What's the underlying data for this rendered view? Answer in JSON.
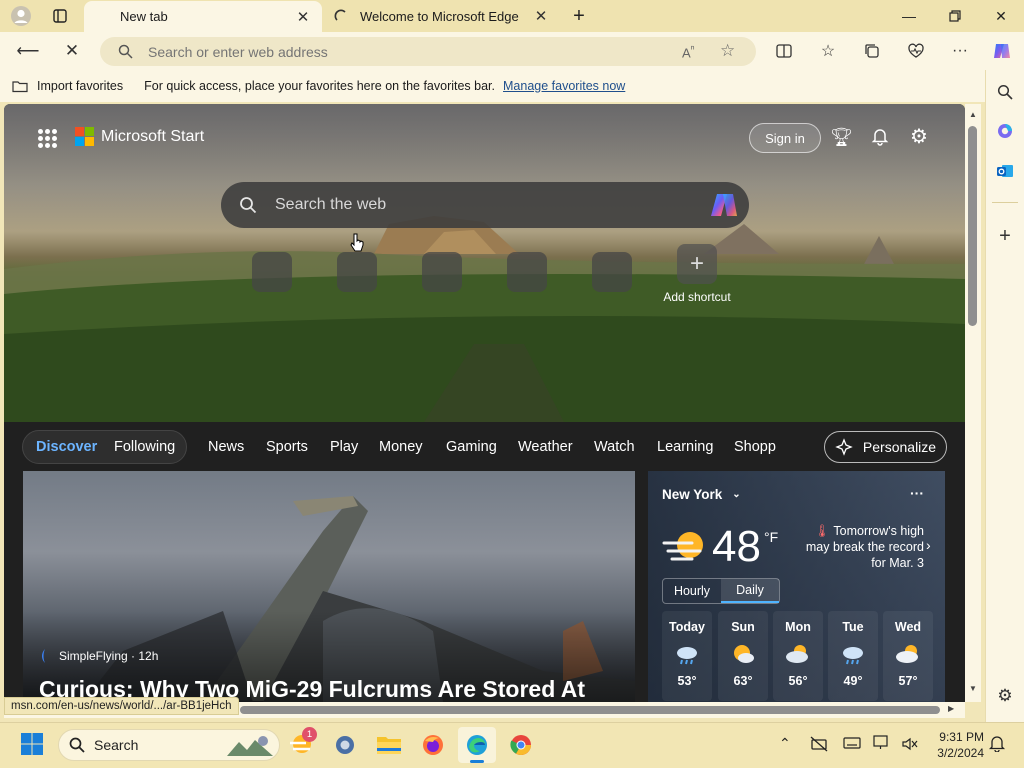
{
  "browser": {
    "tabs": [
      {
        "label": "New tab",
        "active": true
      },
      {
        "label": "Welcome to Microsoft Edge",
        "active": false
      }
    ],
    "address_placeholder": "Search or enter web address",
    "favorites_bar": {
      "import_label": "Import favorites",
      "hint": "For quick access, place your favorites here on the favorites bar.",
      "manage_link": "Manage favorites now"
    },
    "status_url": "msn.com/en-us/news/world/.../ar-BB1jeHch"
  },
  "page": {
    "brand": "Microsoft Start",
    "sign_in": "Sign in",
    "search_placeholder": "Search the web",
    "add_shortcut": "Add shortcut",
    "feed_tabs": [
      "Discover",
      "Following",
      "News",
      "Sports",
      "Play",
      "Money",
      "Gaming",
      "Weather",
      "Watch",
      "Learning",
      "Shopp"
    ],
    "active_feed_tab": "Discover",
    "personalize": "Personalize",
    "news": {
      "source": "SimpleFlying · 12h",
      "headline": "Curious: Why Two MiG-29 Fulcrums Are Stored At"
    },
    "weather": {
      "location": "New York",
      "temperature": "48",
      "unit": "°F",
      "note": "Tomorrow's high may break the record for Mar. 3",
      "toggle": [
        "Hourly",
        "Daily"
      ],
      "active_toggle": "Daily",
      "days": [
        {
          "day": "Today",
          "temp": "53°",
          "icon": "rain-cloud-icon"
        },
        {
          "day": "Sun",
          "temp": "63°",
          "icon": "partly-sunny-icon"
        },
        {
          "day": "Mon",
          "temp": "56°",
          "icon": "cloudy-icon"
        },
        {
          "day": "Tue",
          "temp": "49°",
          "icon": "rain-cloud-icon"
        },
        {
          "day": "Wed",
          "temp": "57°",
          "icon": "partly-cloudy-icon"
        }
      ]
    }
  },
  "taskbar": {
    "search_label": "Search",
    "notification_count": "1",
    "time": "9:31 PM",
    "date": "3/2/2024"
  },
  "colors": {
    "chrome_bg": "#fbf6e4",
    "titlebar_bg": "#efe3b0",
    "accent": "#3b9cf0",
    "link": "#1f4f8c"
  }
}
